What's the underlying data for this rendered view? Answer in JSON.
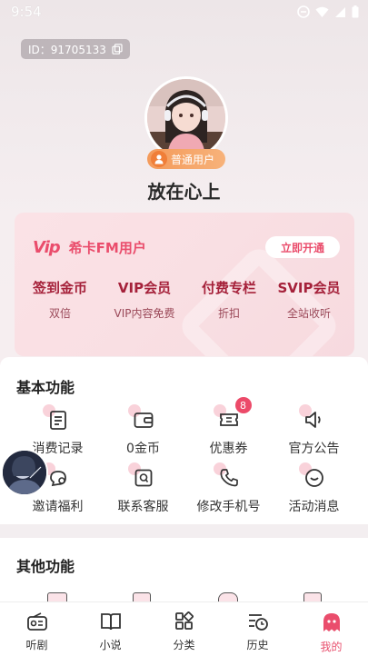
{
  "status": {
    "time": "9:54"
  },
  "profile": {
    "id_text": "ID：91705133",
    "badge": "普通用户",
    "name": "放在心上"
  },
  "vip": {
    "logo": "Vip",
    "title": "希卡FM用户",
    "open_label": "立即开通",
    "perks": [
      {
        "title": "签到金币",
        "sub": "双倍"
      },
      {
        "title": "VIP会员",
        "sub": "VIP内容免费"
      },
      {
        "title": "付费专栏",
        "sub": "折扣"
      },
      {
        "title": "SVIP会员",
        "sub": "全站收听"
      }
    ]
  },
  "basic": {
    "title": "基本功能",
    "items": [
      {
        "label": "消费记录",
        "icon": "receipt-icon"
      },
      {
        "label": "0金币",
        "icon": "wallet-icon"
      },
      {
        "label": "优惠券",
        "icon": "coupon-icon",
        "badge": "8"
      },
      {
        "label": "官方公告",
        "icon": "speaker-icon"
      },
      {
        "label": "邀请福利",
        "icon": "invite-icon"
      },
      {
        "label": "联系客服",
        "icon": "service-icon"
      },
      {
        "label": "修改手机号",
        "icon": "phone-icon"
      },
      {
        "label": "活动消息",
        "icon": "message-icon"
      }
    ]
  },
  "other": {
    "title": "其他功能"
  },
  "tabs": [
    {
      "label": "听剧",
      "icon": "radio-icon"
    },
    {
      "label": "小说",
      "icon": "book-icon"
    },
    {
      "label": "分类",
      "icon": "category-icon"
    },
    {
      "label": "历史",
      "icon": "history-icon"
    },
    {
      "label": "我的",
      "icon": "ghost-icon",
      "active": true
    }
  ],
  "colors": {
    "accent": "#ea4d6c",
    "perk_title": "#a5213a",
    "badge": "#f49a5a"
  }
}
